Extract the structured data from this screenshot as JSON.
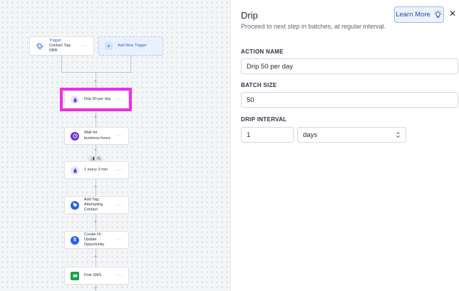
{
  "canvas": {
    "trigger": {
      "title": "Trigger",
      "subtitle": "Contact Tag- DBR"
    },
    "add_trigger_label": "Add New Trigger",
    "steps": [
      {
        "label": "Drip 50 per day",
        "icon": "drip-icon",
        "color": "#7c3aed"
      },
      {
        "label": "Wait for business hours",
        "icon": "clock-icon",
        "color": "#6d28d9"
      },
      {
        "label": "1 every 3 min",
        "icon": "drip-icon",
        "color": "#7c3aed"
      },
      {
        "label": "Add Tag: Attempting Contact",
        "icon": "tag-icon",
        "color": "#2563eb"
      },
      {
        "label": "Create Or Update Opportunity",
        "icon": "dollar-icon",
        "color": "#2563eb"
      },
      {
        "label": "First SMS",
        "icon": "sms-icon",
        "color": "#16a34a"
      }
    ],
    "count_badge": "76",
    "node_menu": "···",
    "plus_symbol": "+"
  },
  "panel": {
    "title": "Drip",
    "subtitle": "Proceed to next step in batches, at regular interval.",
    "learn_more": "Learn More",
    "close": "✕",
    "action_name_label": "ACTION NAME",
    "action_name_value": "Drip 50 per day",
    "batch_size_label": "BATCH SIZE",
    "batch_size_value": "50",
    "drip_interval_label": "DRIP INTERVAL",
    "drip_interval_value": "1",
    "drip_interval_unit": "days"
  },
  "colors": {
    "highlight": "#f02ee6",
    "accent": "#2563eb"
  }
}
